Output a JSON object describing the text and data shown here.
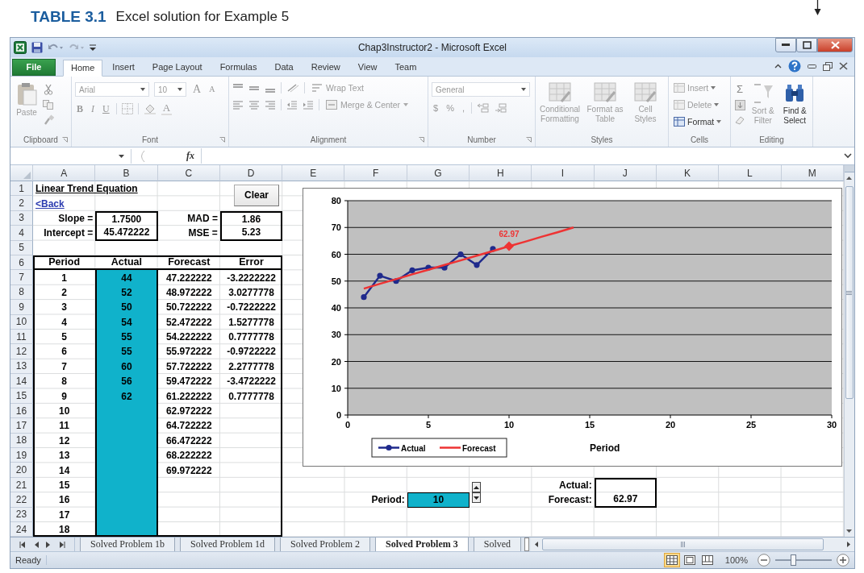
{
  "caption": {
    "label": "TABLE 3.1",
    "text": "Excel solution for Example 5"
  },
  "window": {
    "title": "Chap3Instructor2 - Microsoft Excel"
  },
  "tabs": [
    {
      "label": "File",
      "kind": "file",
      "selected": false
    },
    {
      "label": "Home",
      "kind": "tab",
      "selected": true
    },
    {
      "label": "Insert",
      "kind": "tab",
      "selected": false
    },
    {
      "label": "Page Layout",
      "kind": "tab",
      "selected": false
    },
    {
      "label": "Formulas",
      "kind": "tab",
      "selected": false
    },
    {
      "label": "Data",
      "kind": "tab",
      "selected": false
    },
    {
      "label": "Review",
      "kind": "tab",
      "selected": false
    },
    {
      "label": "View",
      "kind": "tab",
      "selected": false
    },
    {
      "label": "Team",
      "kind": "tab",
      "selected": false
    }
  ],
  "ribbon": {
    "clipboard": {
      "label": "Clipboard",
      "paste": "Paste"
    },
    "font": {
      "label": "Font",
      "font_name": "Arial",
      "font_size": "10",
      "grow": "A",
      "shrink": "A",
      "bold": "B",
      "italic": "I",
      "underline": "U",
      "font_color": "A"
    },
    "alignment": {
      "label": "Alignment",
      "wrap": "Wrap Text",
      "merge": "Merge & Center"
    },
    "number": {
      "label": "Number",
      "format": "General",
      "currency": "$",
      "percent": "%",
      "comma": ","
    },
    "styles": {
      "label": "Styles",
      "buttons": [
        {
          "label": "Conditional Formatting",
          "disabled": true
        },
        {
          "label": "Format as Table",
          "disabled": true
        },
        {
          "label": "Cell Styles",
          "disabled": true
        }
      ]
    },
    "cells": {
      "label": "Cells",
      "buttons": [
        {
          "label": "Insert",
          "disabled": true
        },
        {
          "label": "Delete",
          "disabled": true
        },
        {
          "label": "Format",
          "disabled": false
        }
      ]
    },
    "editing": {
      "label": "Editing",
      "sum": "Σ",
      "buttons": [
        {
          "label": "Sort & Filter",
          "disabled": true
        },
        {
          "label": "Find & Select",
          "disabled": false
        }
      ]
    }
  },
  "formula_bar": {
    "function_label": "fx"
  },
  "columns": [
    "A",
    "B",
    "C",
    "D",
    "E",
    "F",
    "G",
    "H",
    "I",
    "J",
    "K",
    "L",
    "M"
  ],
  "rows": [
    {
      "number": "1",
      "cells": {
        "A": {
          "text": "Linear Trend Equation",
          "kind": "title"
        }
      }
    },
    {
      "number": "2",
      "cells": {
        "A": {
          "text": "<Back",
          "kind": "link"
        }
      }
    },
    {
      "number": "3",
      "cells": {
        "A": {
          "text": "Slope =",
          "kind": "label"
        },
        "B": {
          "text": "1.7500",
          "kind": "box_top"
        },
        "C": {
          "text": "MAD =",
          "kind": "label"
        },
        "D": {
          "text": "1.86",
          "kind": "box_top"
        }
      }
    },
    {
      "number": "4",
      "cells": {
        "A": {
          "text": "Intercept =",
          "kind": "label"
        },
        "B": {
          "text": "45.472222",
          "kind": "box_bottom"
        },
        "C": {
          "text": "MSE =",
          "kind": "label"
        },
        "D": {
          "text": "5.23",
          "kind": "box_bottom"
        }
      }
    },
    {
      "number": "5",
      "cells": {}
    },
    {
      "number": "6",
      "cells": {
        "A": {
          "text": "Period",
          "kind": "header"
        },
        "B": {
          "text": "Actual",
          "kind": "header"
        },
        "C": {
          "text": "Forecast",
          "kind": "header"
        },
        "D": {
          "text": "Error",
          "kind": "header"
        }
      }
    },
    {
      "number": "7",
      "cells": {
        "A": {
          "text": "1",
          "kind": "value"
        },
        "B": {
          "text": "44",
          "kind": "value"
        },
        "C": {
          "text": "47.222222",
          "kind": "value"
        },
        "D": {
          "text": "-3.2222222",
          "kind": "value"
        }
      }
    },
    {
      "number": "8",
      "cells": {
        "A": {
          "text": "2",
          "kind": "value"
        },
        "B": {
          "text": "52",
          "kind": "value"
        },
        "C": {
          "text": "48.972222",
          "kind": "value"
        },
        "D": {
          "text": "3.0277778",
          "kind": "value"
        }
      }
    },
    {
      "number": "9",
      "cells": {
        "A": {
          "text": "3",
          "kind": "value"
        },
        "B": {
          "text": "50",
          "kind": "value"
        },
        "C": {
          "text": "50.722222",
          "kind": "value"
        },
        "D": {
          "text": "-0.7222222",
          "kind": "value"
        }
      }
    },
    {
      "number": "10",
      "cells": {
        "A": {
          "text": "4",
          "kind": "value"
        },
        "B": {
          "text": "54",
          "kind": "value"
        },
        "C": {
          "text": "52.472222",
          "kind": "value"
        },
        "D": {
          "text": "1.5277778",
          "kind": "value"
        }
      }
    },
    {
      "number": "11",
      "cells": {
        "A": {
          "text": "5",
          "kind": "value"
        },
        "B": {
          "text": "55",
          "kind": "value"
        },
        "C": {
          "text": "54.222222",
          "kind": "value"
        },
        "D": {
          "text": "0.7777778",
          "kind": "value"
        }
      }
    },
    {
      "number": "12",
      "cells": {
        "A": {
          "text": "6",
          "kind": "value"
        },
        "B": {
          "text": "55",
          "kind": "value"
        },
        "C": {
          "text": "55.972222",
          "kind": "value"
        },
        "D": {
          "text": "-0.9722222",
          "kind": "value"
        }
      }
    },
    {
      "number": "13",
      "cells": {
        "A": {
          "text": "7",
          "kind": "value"
        },
        "B": {
          "text": "60",
          "kind": "value"
        },
        "C": {
          "text": "57.722222",
          "kind": "value"
        },
        "D": {
          "text": "2.2777778",
          "kind": "value"
        }
      }
    },
    {
      "number": "14",
      "cells": {
        "A": {
          "text": "8",
          "kind": "value"
        },
        "B": {
          "text": "56",
          "kind": "value"
        },
        "C": {
          "text": "59.472222",
          "kind": "value"
        },
        "D": {
          "text": "-3.4722222",
          "kind": "value"
        }
      }
    },
    {
      "number": "15",
      "cells": {
        "A": {
          "text": "9",
          "kind": "value"
        },
        "B": {
          "text": "62",
          "kind": "value"
        },
        "C": {
          "text": "61.222222",
          "kind": "value"
        },
        "D": {
          "text": "0.7777778",
          "kind": "value"
        }
      }
    },
    {
      "number": "16",
      "cells": {
        "A": {
          "text": "10",
          "kind": "value"
        },
        "C": {
          "text": "62.972222",
          "kind": "value"
        }
      }
    },
    {
      "number": "17",
      "cells": {
        "A": {
          "text": "11",
          "kind": "value"
        },
        "C": {
          "text": "64.722222",
          "kind": "value"
        }
      }
    },
    {
      "number": "18",
      "cells": {
        "A": {
          "text": "12",
          "kind": "value"
        },
        "C": {
          "text": "66.472222",
          "kind": "value"
        }
      }
    },
    {
      "number": "19",
      "cells": {
        "A": {
          "text": "13",
          "kind": "value"
        },
        "C": {
          "text": "68.222222",
          "kind": "value"
        }
      }
    },
    {
      "number": "20",
      "cells": {
        "A": {
          "text": "14",
          "kind": "value"
        },
        "C": {
          "text": "69.972222",
          "kind": "value"
        }
      }
    },
    {
      "number": "21",
      "cells": {
        "A": {
          "text": "15",
          "kind": "value"
        },
        "I": {
          "text": "Actual:",
          "kind": "label"
        },
        "J": {
          "kind": "box_top"
        }
      }
    },
    {
      "number": "22",
      "cells": {
        "A": {
          "text": "16",
          "kind": "value"
        },
        "F": {
          "text": "Period:",
          "kind": "label"
        },
        "G": {
          "text": "10",
          "kind": "spin_input"
        },
        "I": {
          "text": "Forecast:",
          "kind": "label"
        },
        "J": {
          "text": "62.97",
          "kind": "box_bottom"
        }
      }
    },
    {
      "number": "23",
      "cells": {
        "A": {
          "text": "17",
          "kind": "value"
        }
      }
    },
    {
      "number": "24",
      "cells": {
        "A": {
          "text": "18",
          "kind": "value"
        }
      }
    }
  ],
  "clear_button": "Clear",
  "chart": {
    "chart_data": {
      "type": "line",
      "xlabel": "Period",
      "x": [
        1,
        2,
        3,
        4,
        5,
        6,
        7,
        8,
        9,
        10,
        11,
        12,
        13,
        14
      ],
      "series": [
        {
          "name": "Actual",
          "color": "#1f2a8c",
          "marker": "circle",
          "values": [
            44,
            52,
            50,
            54,
            55,
            55,
            60,
            56,
            62,
            null,
            null,
            null,
            null,
            null
          ]
        },
        {
          "name": "Forecast",
          "color": "#ee3333",
          "values": [
            47.2,
            49.0,
            50.7,
            52.5,
            54.2,
            56.0,
            57.7,
            59.5,
            61.2,
            63.0,
            64.7,
            66.5,
            68.2,
            70.0
          ]
        }
      ],
      "grid": true,
      "legend": true,
      "xlim": [
        0,
        30
      ],
      "ylim": [
        0,
        80
      ],
      "xticks": [
        0,
        5,
        10,
        15,
        20,
        25,
        30
      ],
      "yticks": [
        0,
        10,
        20,
        30,
        40,
        50,
        60,
        70,
        80
      ],
      "annotations": [
        {
          "x": 10,
          "y": 62.97,
          "text": "62.97"
        }
      ]
    }
  },
  "sheet_tabs": [
    {
      "label": "Solved Problem 1b",
      "selected": false
    },
    {
      "label": "Solved Problem 1d",
      "selected": false
    },
    {
      "label": "Solved Problem 2",
      "selected": false
    },
    {
      "label": "Solved Problem 3",
      "selected": true
    },
    {
      "label": "Solved",
      "selected": false
    }
  ],
  "status_bar": {
    "text": "Ready",
    "zoom": "100%",
    "zoom_slider": {
      "level": 0.32
    },
    "views": [
      {
        "kind": "normal",
        "selected": true
      },
      {
        "kind": "page_layout",
        "selected": false
      },
      {
        "kind": "page_break",
        "selected": false
      }
    ]
  }
}
